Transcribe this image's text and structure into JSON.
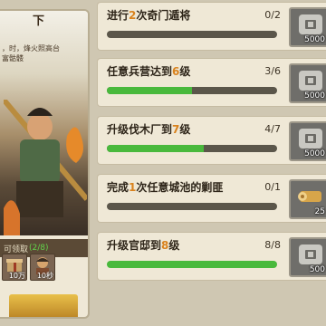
{
  "left_card": {
    "title": "下",
    "description": "，时，烽火照高台\n富骷髅",
    "progress_label": "可领取",
    "progress_value": "(2/8)",
    "rewards": [
      {
        "icon": "gift-icon",
        "qty": "10万"
      },
      {
        "icon": "general-portrait-icon",
        "qty": "10秒"
      }
    ]
  },
  "tasks": [
    {
      "title_pre": "进行",
      "title_hl": "2",
      "title_post": "次奇门遁将",
      "count": "0/2",
      "progress": 0.0,
      "reward_icon": "silver-coin-icon",
      "reward_qty": "5000"
    },
    {
      "title_pre": "任意兵营达到",
      "title_hl": "6",
      "title_post": "级",
      "count": "3/6",
      "progress": 0.5,
      "reward_icon": "silver-coin-icon",
      "reward_qty": "5000"
    },
    {
      "title_pre": "升级伐木厂到",
      "title_hl": "7",
      "title_post": "级",
      "count": "4/7",
      "progress": 0.5714,
      "reward_icon": "silver-coin-icon",
      "reward_qty": "5000"
    },
    {
      "title_pre": "完成",
      "title_hl": "1",
      "title_post": "次任意城池的剿匪",
      "count": "0/1",
      "progress": 0.0,
      "reward_icon": "wood-log-icon",
      "reward_qty": "25"
    },
    {
      "title_pre": "升级官邸到",
      "title_hl": "8",
      "title_post": "级",
      "count": "8/8",
      "progress": 1.0,
      "reward_icon": "silver-coin-icon",
      "reward_qty": "500"
    }
  ],
  "colors": {
    "highlight": "#d9821d",
    "progress_fill": "#49b93c",
    "progress_track": "#5b564a",
    "card_bg": "#efe8d6"
  }
}
